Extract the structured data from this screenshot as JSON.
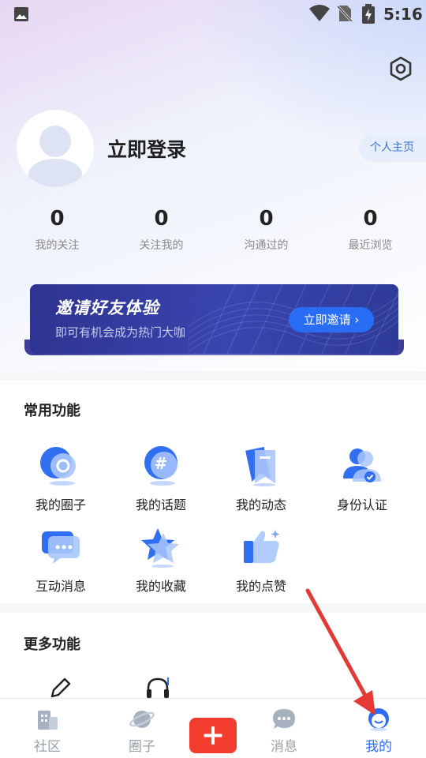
{
  "status_bar": {
    "time": "5:16"
  },
  "header": {
    "login_text": "立即登录",
    "profile_button": "个人主页"
  },
  "stats": [
    {
      "value": "0",
      "label": "我的关注"
    },
    {
      "value": "0",
      "label": "关注我的"
    },
    {
      "value": "0",
      "label": "沟通过的"
    },
    {
      "value": "0",
      "label": "最近浏览"
    }
  ],
  "invite": {
    "title": "邀请好友体验",
    "subtitle": "即可有机会成为热门大咖",
    "button": "立即邀请 ›"
  },
  "common_functions": {
    "title": "常用功能",
    "items": [
      {
        "label": "我的圈子",
        "icon": "circle-chat-icon"
      },
      {
        "label": "我的话题",
        "icon": "topic-hash-icon"
      },
      {
        "label": "我的动态",
        "icon": "bookmark-icon"
      },
      {
        "label": "身份认证",
        "icon": "identity-verify-icon"
      },
      {
        "label": "互动消息",
        "icon": "message-bubble-icon"
      },
      {
        "label": "我的收藏",
        "icon": "star-icon"
      },
      {
        "label": "我的点赞",
        "icon": "thumbs-up-icon"
      }
    ]
  },
  "more_functions": {
    "title": "更多功能",
    "items": [
      {
        "icon": "pencil-icon"
      },
      {
        "icon": "headset-icon"
      }
    ]
  },
  "bottom_nav": [
    {
      "label": "社区",
      "icon": "community-building-icon",
      "active": false
    },
    {
      "label": "圈子",
      "icon": "planet-icon",
      "active": false
    },
    {
      "label": "消息",
      "icon": "chat-bubble-icon",
      "active": false
    },
    {
      "label": "我的",
      "icon": "profile-face-icon",
      "active": true
    }
  ],
  "colors": {
    "accent": "#2b6cf2",
    "post_button": "#f23c2e",
    "annotation_arrow": "#e53935"
  }
}
